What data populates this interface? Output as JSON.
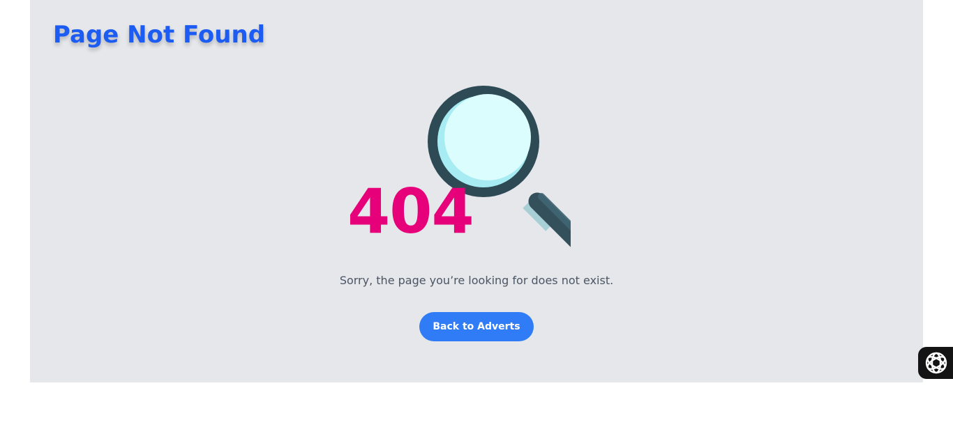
{
  "page": {
    "title": "Page Not Found",
    "error_code": "404",
    "message": "Sorry, the page you’re looking for does not exist.",
    "back_button_label": "Back to Adverts"
  },
  "icons": {
    "illustration": "magnifying-glass-icon",
    "assistant_widget": "assistant-logo-icon"
  },
  "colors": {
    "panel_background": "#e5e7eb",
    "title": "#1d5cf2",
    "error_code": "#e6007a",
    "button": "#2f7cf6",
    "message": "#4b5563"
  }
}
